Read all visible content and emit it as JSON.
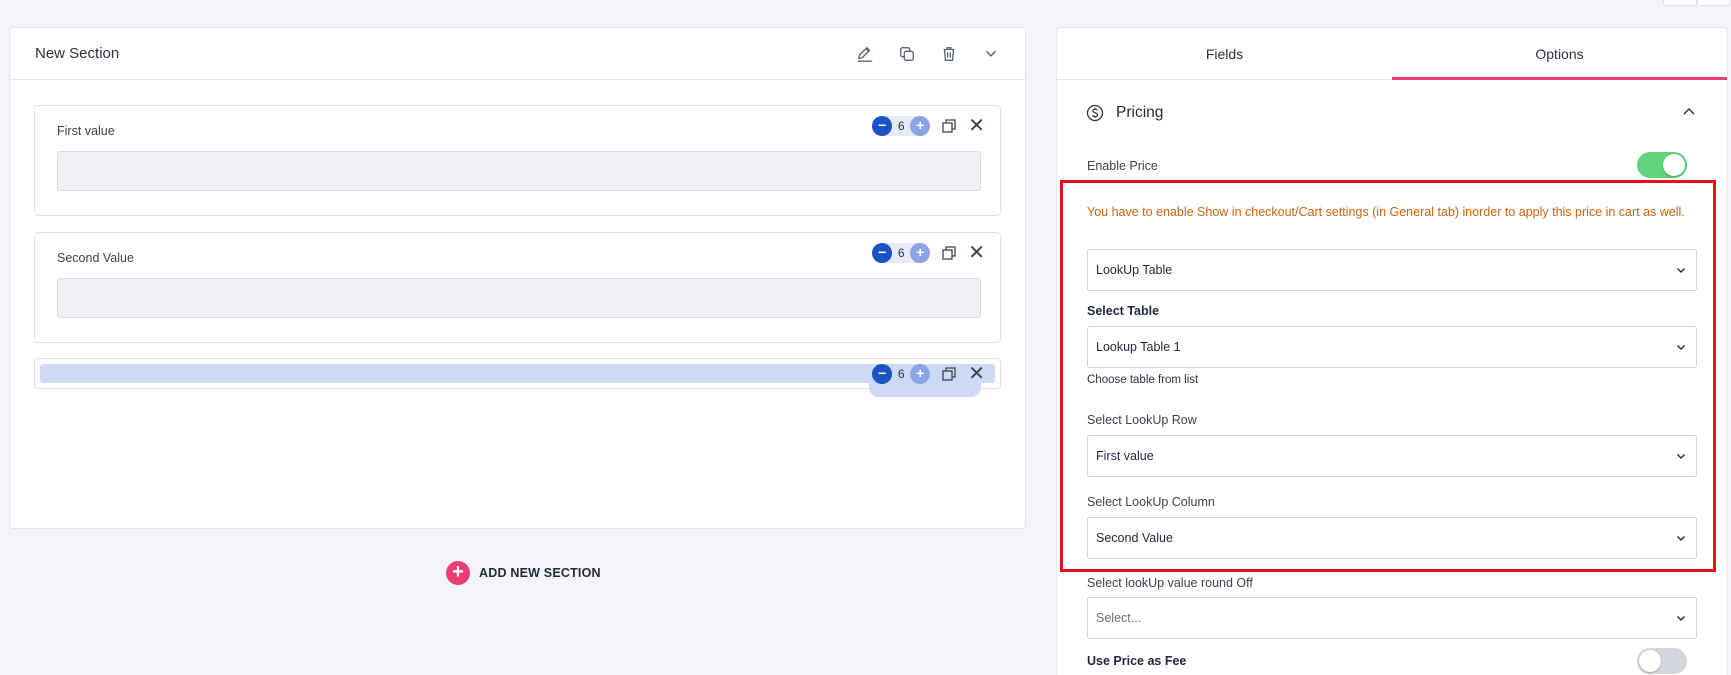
{
  "section": {
    "title": "New Section",
    "fields": [
      {
        "label": "First value",
        "count": "6"
      },
      {
        "label": "Second Value",
        "count": "6"
      }
    ],
    "dragging": {
      "count": "6"
    }
  },
  "add_section_label": "ADD NEW SECTION",
  "icons": {
    "minus": "−",
    "plus": "+",
    "close": "✕",
    "add": "+"
  },
  "panel": {
    "tabs": [
      "Fields",
      "Options"
    ],
    "active_tab": "Options",
    "pricing_title": "Pricing",
    "enable_price_label": "Enable Price",
    "enable_price_on": true,
    "warning": "You have to enable Show in checkout/Cart settings (in General tab) inorder to apply this price in cart as well.",
    "price_type": "LookUp Table",
    "select_table_label": "Select Table",
    "select_table_value": "Lookup Table 1",
    "select_table_help": "Choose table from list",
    "lookup_row_label": "Select LookUp Row",
    "lookup_row_value": "First value",
    "lookup_column_label": "Select LookUp Column",
    "lookup_column_value": "Second Value",
    "round_off_label": "Select lookUp value round Off",
    "round_off_placeholder": "Select...",
    "price_as_fee_label": "Use Price as Fee",
    "price_as_fee_on": false
  },
  "colors": {
    "accent_pink": "#e83e74",
    "toggle_on": "#5fd37d",
    "warning": "#d0620e",
    "highlight": "#e8101a"
  }
}
